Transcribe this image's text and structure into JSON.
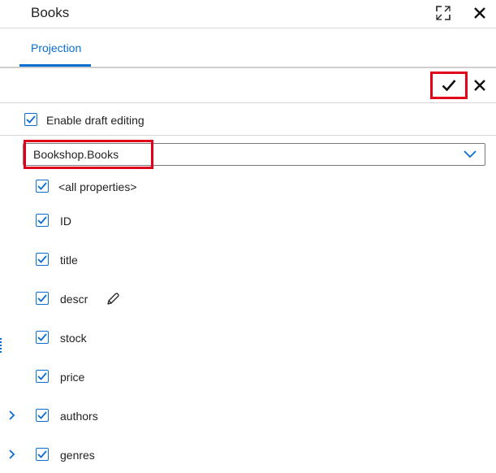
{
  "header": {
    "title": "Books"
  },
  "tabs": [
    {
      "label": "Projection"
    }
  ],
  "draft": {
    "label": "Enable draft editing",
    "checked": true
  },
  "entity_select": {
    "value": "Bookshop.Books"
  },
  "properties": [
    {
      "label": "<all properties>",
      "checked": true
    },
    {
      "label": "ID",
      "checked": true
    },
    {
      "label": "title",
      "checked": true
    },
    {
      "label": "descr",
      "checked": true
    },
    {
      "label": "stock",
      "checked": true
    },
    {
      "label": "price",
      "checked": true
    },
    {
      "label": "authors",
      "checked": true
    },
    {
      "label": "genres",
      "checked": true
    }
  ],
  "colors": {
    "accent": "#0a6ed1",
    "highlight": "#e0001b"
  }
}
